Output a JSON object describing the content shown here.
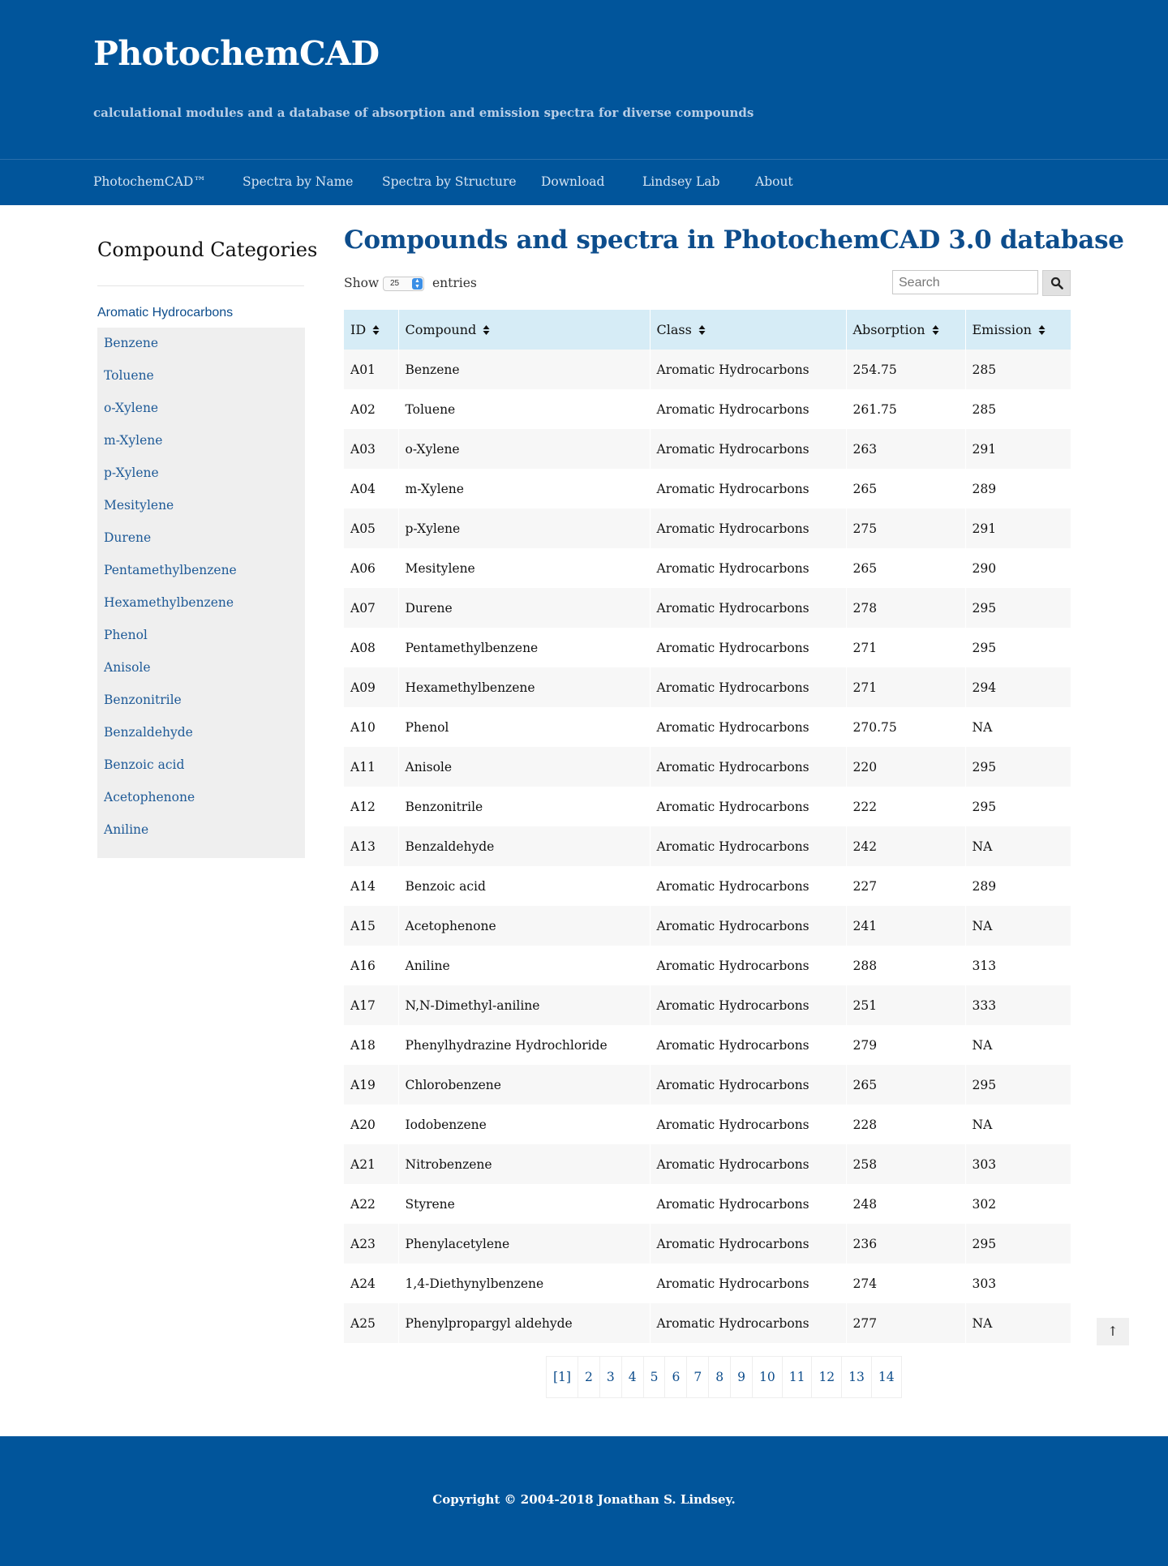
{
  "header": {
    "title": "PhotochemCAD",
    "tagline": "calculational modules and a database of absorption and emission spectra for diverse compounds"
  },
  "nav": {
    "items": [
      "PhotochemCAD™",
      "Spectra by Name",
      "Spectra by Structure",
      "Download",
      "Lindsey Lab",
      "About"
    ]
  },
  "sidebar": {
    "title": "Compound Categories",
    "category": "Aromatic Hydrocarbons",
    "items": [
      "Benzene",
      "Toluene",
      "o-Xylene",
      "m-Xylene",
      "p-Xylene",
      "Mesitylene",
      "Durene",
      "Pentamethylbenzene",
      "Hexamethylbenzene",
      "Phenol",
      "Anisole",
      "Benzonitrile",
      "Benzaldehyde",
      "Benzoic acid",
      "Acetophenone",
      "Aniline"
    ]
  },
  "main": {
    "title": "Compounds and spectra in PhotochemCAD 3.0 database",
    "show_label": "Show",
    "page_length": "25",
    "entries_label": "entries",
    "search_placeholder": "Search"
  },
  "table": {
    "columns": [
      "ID",
      "Compound",
      "Class",
      "Absorption",
      "Emission"
    ],
    "rows": [
      [
        "A01",
        "Benzene",
        "Aromatic Hydrocarbons",
        "254.75",
        "285"
      ],
      [
        "A02",
        "Toluene",
        "Aromatic Hydrocarbons",
        "261.75",
        "285"
      ],
      [
        "A03",
        "o-Xylene",
        "Aromatic Hydrocarbons",
        "263",
        "291"
      ],
      [
        "A04",
        "m-Xylene",
        "Aromatic Hydrocarbons",
        "265",
        "289"
      ],
      [
        "A05",
        "p-Xylene",
        "Aromatic Hydrocarbons",
        "275",
        "291"
      ],
      [
        "A06",
        "Mesitylene",
        "Aromatic Hydrocarbons",
        "265",
        "290"
      ],
      [
        "A07",
        "Durene",
        "Aromatic Hydrocarbons",
        "278",
        "295"
      ],
      [
        "A08",
        "Pentamethylbenzene",
        "Aromatic Hydrocarbons",
        "271",
        "295"
      ],
      [
        "A09",
        "Hexamethylbenzene",
        "Aromatic Hydrocarbons",
        "271",
        "294"
      ],
      [
        "A10",
        "Phenol",
        "Aromatic Hydrocarbons",
        "270.75",
        "NA"
      ],
      [
        "A11",
        "Anisole",
        "Aromatic Hydrocarbons",
        "220",
        "295"
      ],
      [
        "A12",
        "Benzonitrile",
        "Aromatic Hydrocarbons",
        "222",
        "295"
      ],
      [
        "A13",
        "Benzaldehyde",
        "Aromatic Hydrocarbons",
        "242",
        "NA"
      ],
      [
        "A14",
        "Benzoic acid",
        "Aromatic Hydrocarbons",
        "227",
        "289"
      ],
      [
        "A15",
        "Acetophenone",
        "Aromatic Hydrocarbons",
        "241",
        "NA"
      ],
      [
        "A16",
        "Aniline",
        "Aromatic Hydrocarbons",
        "288",
        "313"
      ],
      [
        "A17",
        "N,N-Dimethyl-aniline",
        "Aromatic Hydrocarbons",
        "251",
        "333"
      ],
      [
        "A18",
        "Phenylhydrazine Hydrochloride",
        "Aromatic Hydrocarbons",
        "279",
        "NA"
      ],
      [
        "A19",
        "Chlorobenzene",
        "Aromatic Hydrocarbons",
        "265",
        "295"
      ],
      [
        "A20",
        "Iodobenzene",
        "Aromatic Hydrocarbons",
        "228",
        "NA"
      ],
      [
        "A21",
        "Nitrobenzene",
        "Aromatic Hydrocarbons",
        "258",
        "303"
      ],
      [
        "A22",
        "Styrene",
        "Aromatic Hydrocarbons",
        "248",
        "302"
      ],
      [
        "A23",
        "Phenylacetylene",
        "Aromatic Hydrocarbons",
        "236",
        "295"
      ],
      [
        "A24",
        "1,4-Diethynylbenzene",
        "Aromatic Hydrocarbons",
        "274",
        "303"
      ],
      [
        "A25",
        "Phenylpropargyl aldehyde",
        "Aromatic Hydrocarbons",
        "277",
        "NA"
      ]
    ]
  },
  "pagination": {
    "pages": [
      "[1]",
      "2",
      "3",
      "4",
      "5",
      "6",
      "7",
      "8",
      "9",
      "10",
      "11",
      "12",
      "13",
      "14"
    ]
  },
  "back_to_top": "↑",
  "footer": {
    "copyright": "Copyright © 2004-2018 Jonathan S. Lindsey."
  },
  "icons": {
    "search": "search-icon",
    "sort": "sort-icon",
    "select_arrows": "select-arrows-icon"
  },
  "colors": {
    "brand": "#01559b",
    "link": "#0d4d8c",
    "table_header": "#d6ecf6"
  }
}
